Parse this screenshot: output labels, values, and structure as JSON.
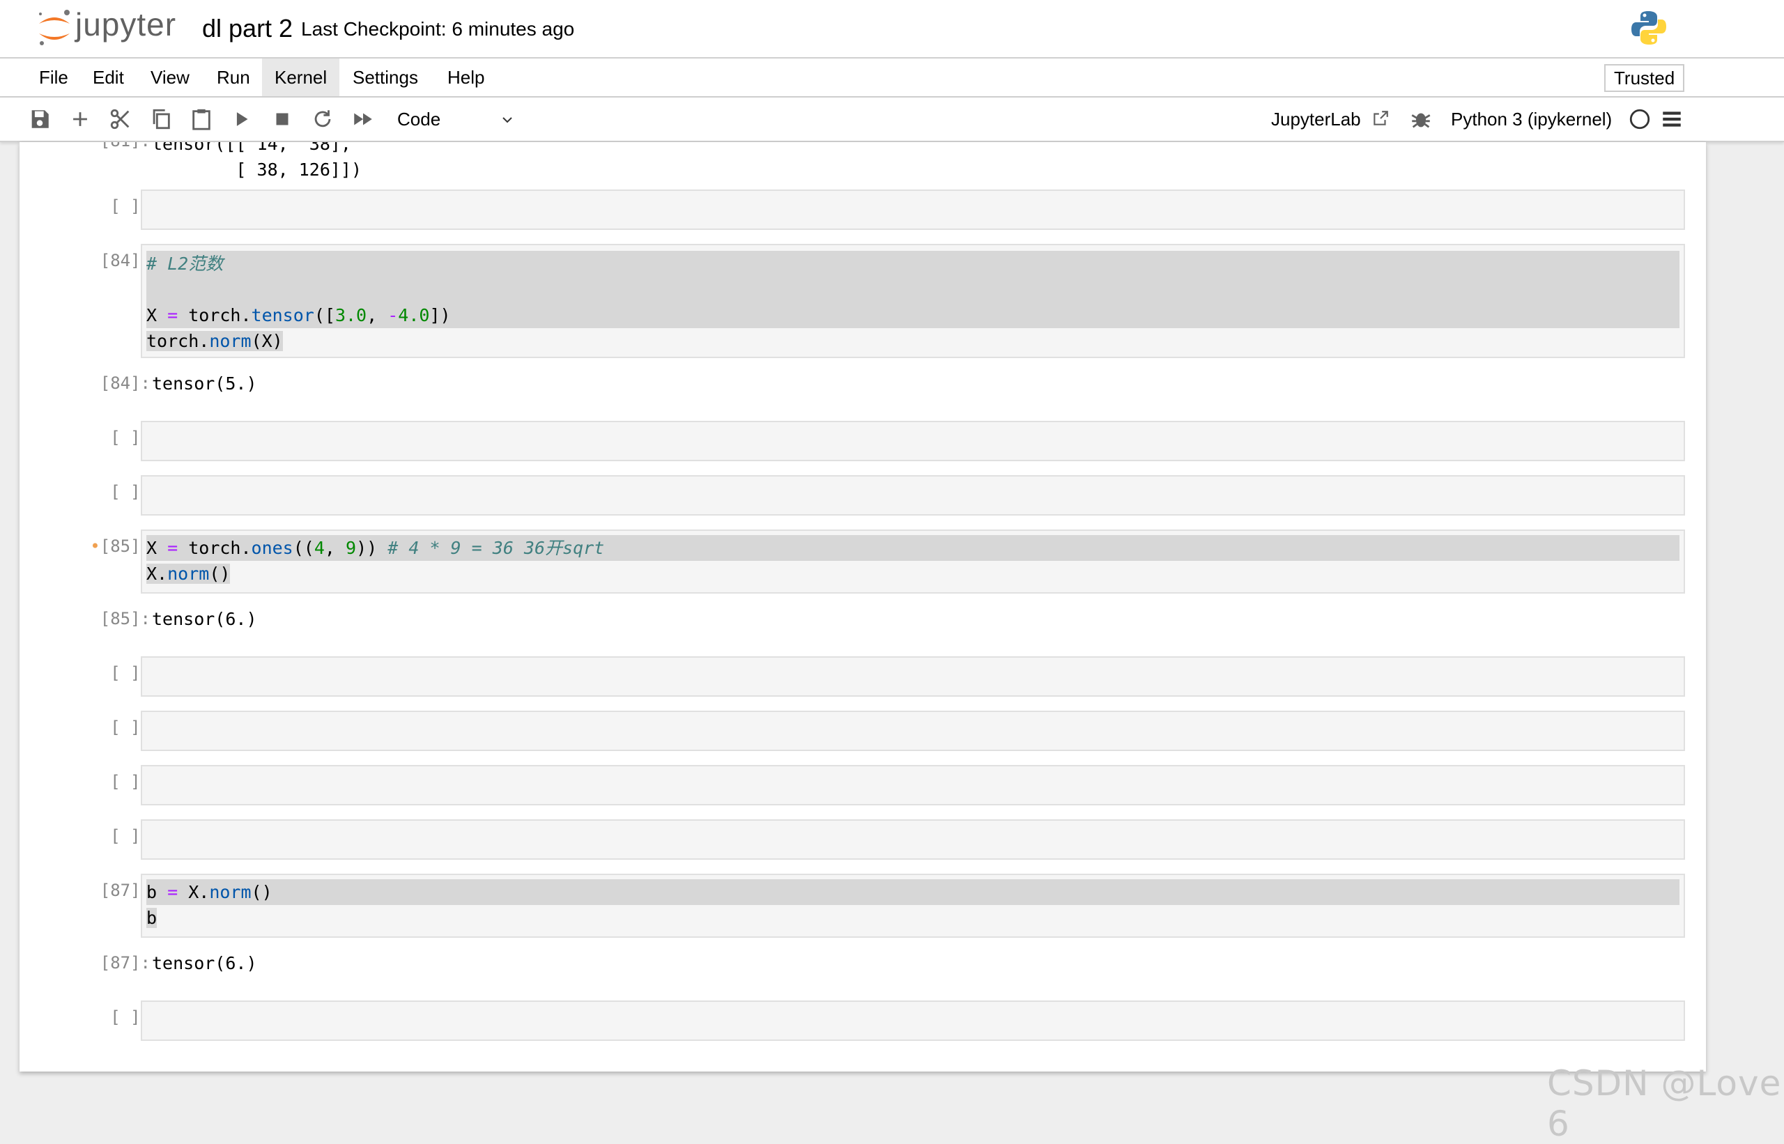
{
  "header": {
    "brand": "jupyter",
    "notebook_title": "dl part 2",
    "checkpoint": "Last Checkpoint: 6 minutes ago"
  },
  "menu": {
    "items": [
      "File",
      "Edit",
      "View",
      "Run",
      "Kernel",
      "Settings",
      "Help"
    ],
    "active": "Kernel",
    "trusted": "Trusted"
  },
  "toolbar": {
    "cell_type": "Code",
    "jupyterlab_link": "JupyterLab",
    "kernel_name": "Python 3 (ipykernel)",
    "icons": [
      "save-icon",
      "add-icon",
      "cut-icon",
      "copy-icon",
      "paste-icon",
      "run-icon",
      "stop-icon",
      "restart-icon",
      "fast-forward-icon",
      "chevron-down-icon",
      "external-link-icon",
      "bug-icon",
      "kernel-status-icon",
      "menu-icon"
    ]
  },
  "cells": {
    "out81": {
      "prompt": "[81]:",
      "text": "tensor([[ 14,  38],\n        [ 38, 126]])"
    },
    "empty_prompt": "[ ]:",
    "c84": {
      "prompt": "[84]:",
      "line1": "# L2范数",
      "line3": {
        "a": "X ",
        "b": "=",
        "c": " torch.",
        "d": "tensor",
        "e": "([",
        "f": "3.0",
        "g": ", ",
        "h": "-",
        "i": "4.0",
        "j": "])"
      },
      "line4": {
        "a": "torch.",
        "b": "norm",
        "c": "(X)"
      },
      "out_prompt": "[84]:",
      "out": "tensor(5.)"
    },
    "c85": {
      "prompt": "[85]:",
      "dot": "•",
      "line1": {
        "a": "X ",
        "b": "=",
        "c": " torch.",
        "d": "ones",
        "e": "((",
        "f": "4",
        "g": ", ",
        "h": "9",
        "i": ")) ",
        "j": "# 4 * 9 = 36 36开sqrt"
      },
      "line2": {
        "a": "X.",
        "b": "norm",
        "c": "()"
      },
      "out_prompt": "[85]:",
      "out": "tensor(6.)"
    },
    "c87": {
      "prompt": "[87]:",
      "line1": {
        "a": "b ",
        "b": "=",
        "c": " X.",
        "d": "norm",
        "e": "()"
      },
      "line2": "b",
      "out_prompt": "[87]:",
      "out": "tensor(6.)"
    }
  },
  "watermark": "CSDN @Love 6"
}
